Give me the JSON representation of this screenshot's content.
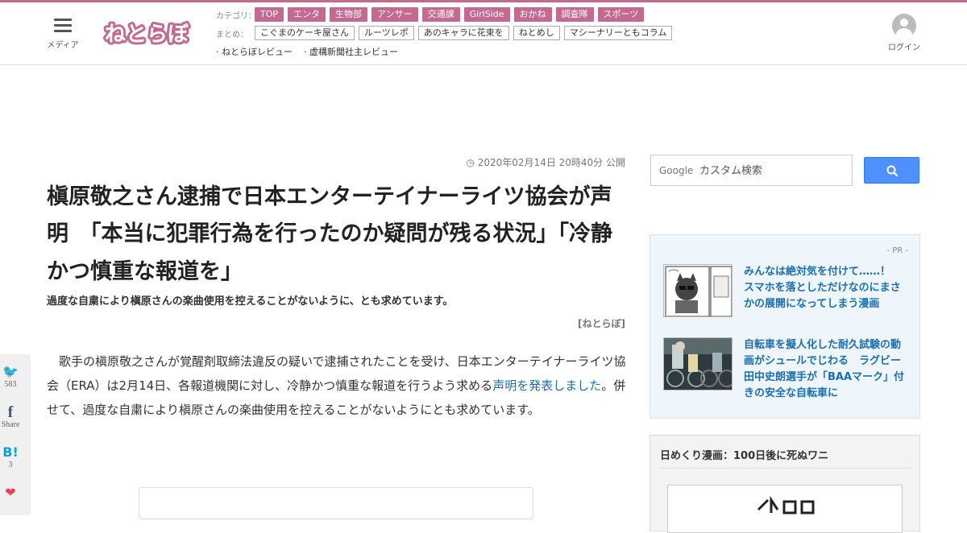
{
  "header": {
    "menu_label": "メディア",
    "logo_text": "ねとらぼ",
    "category_key": "カテゴリ：",
    "categories": [
      "TOP",
      "エンタ",
      "生物部",
      "アンサー",
      "交通課",
      "GirlSide",
      "おかね",
      "調査隊",
      "スポーツ"
    ],
    "summary_key": "まとめ：",
    "summaries": [
      "こぐまのケーキ屋さん",
      "ルーツレポ",
      "あのキャラに花束を",
      "ねとめし",
      "マシーナリーともコラム"
    ],
    "reviews": [
      "· ねとらぼレビュー",
      "· 虚構新聞社主レビュー"
    ],
    "login_label": "ログイン",
    "accent_color": "#c4698f"
  },
  "article": {
    "date": "2020年02月14日 20時40分 公開",
    "title": "槇原敬之さん逮捕で日本エンターテイナーライツ協会が声明　「本当に犯罪行為を行ったのか疑問が残る状況」「冷静かつ慎重な報道を」",
    "subtitle": "過度な自粛により槇原さんの楽曲使用を控えることがないように、とも求めています。",
    "credit": "[ねとらぼ]",
    "body_before": "歌手の槇原敬之さんが覚醒剤取締法違反の疑いで逮捕されたことを受け、日本エンターテイナーライツ協会（ERA）は2月14日、各報道機関に対し、冷静かつ慎重な報道を行うよう求める",
    "body_link": "声明を発表しました",
    "body_after": "。併せて、過度な自粛により槇原さんの楽曲使用を控えることがないようにとも求めています。"
  },
  "share": [
    {
      "icon": "twitter-icon",
      "glyph": "🐦",
      "count": "583",
      "color": "#1da1f2"
    },
    {
      "icon": "facebook-icon",
      "glyph": "f",
      "count": "Share",
      "color": "#3b5998"
    },
    {
      "icon": "hatena-bookmark-icon",
      "glyph": "B!",
      "count": "3",
      "color": "#00a4de"
    },
    {
      "icon": "pocket-icon",
      "glyph": "❤",
      "count": "",
      "color": "#ef3f56"
    }
  ],
  "sidebar": {
    "search_brand": "Google",
    "search_placeholder": "カスタム検索",
    "pr_label": "- PR -",
    "pr_items": [
      "みんなは絶対気を付けて……！　スマホを落としただけなのにまさかの展開になってしまう漫画",
      "自転車を擬人化した耐久試験の動画がシュールでじわる　ラグビー田中史朗選手が「BAAマーク」付きの安全な自転車に"
    ],
    "manga_title": "日めくり漫画：100日後に死ぬワニ",
    "link_color": "#1a6fb3"
  }
}
